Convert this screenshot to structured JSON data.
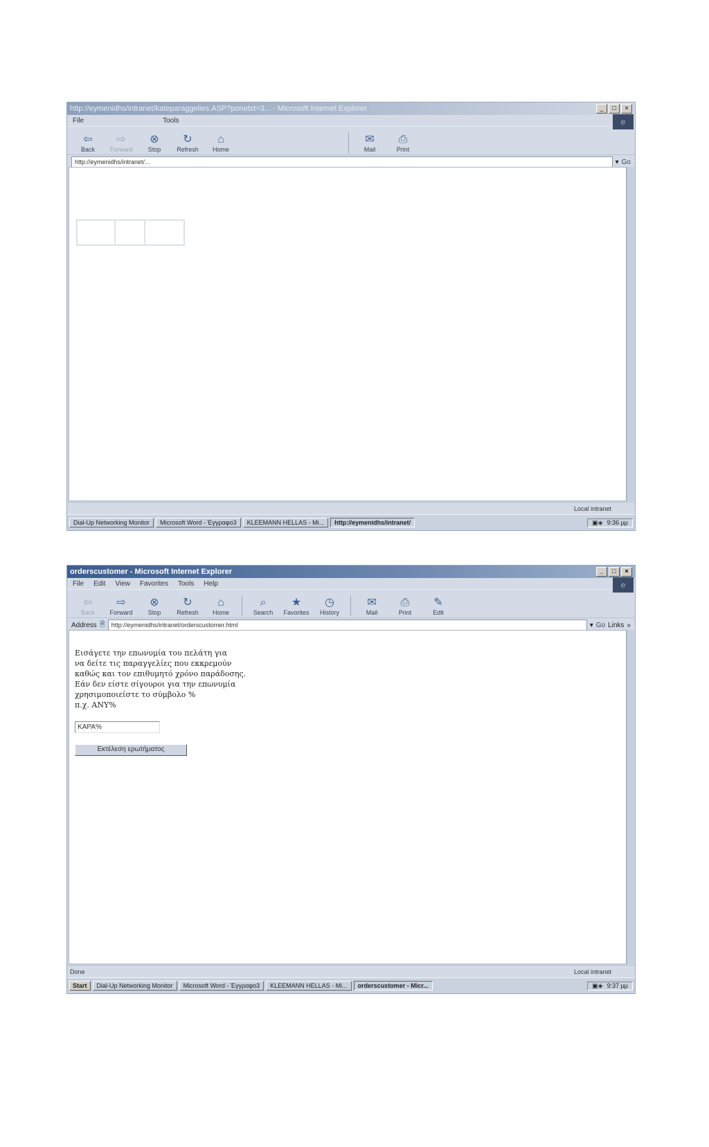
{
  "window1": {
    "title": "http://eymenidhs/intranet/kateparaggelies.ASP?ponetxt=3...  - Microsoft Internet Explorer",
    "menu": [
      "File",
      "Tools"
    ],
    "toolbar": [
      {
        "label": "Back",
        "icon": "back-arrow-icon"
      },
      {
        "label": "Forward",
        "icon": "forward-arrow-icon"
      },
      {
        "label": "Stop",
        "icon": "stop-icon"
      },
      {
        "label": "Refresh",
        "icon": "refresh-icon"
      },
      {
        "label": "Home",
        "icon": "home-icon"
      },
      {
        "label": "Mail",
        "icon": "mail-icon"
      },
      {
        "label": "Print",
        "icon": "print-icon"
      }
    ],
    "address": "http://eymenidhs/intranet/...",
    "go": "Go",
    "status_zone": "Local intranet",
    "taskbar": {
      "tasks": [
        "Dial-Up Networking Monitor",
        "Microsoft Word - Έγγραφο3",
        "KLEEMANN HELLAS - Mi...",
        "http://eymenidhs/intranet/"
      ],
      "clock": "9:36 μμ"
    }
  },
  "window2": {
    "title": "orderscustomer - Microsoft Internet Explorer",
    "menu": [
      "File",
      "Edit",
      "View",
      "Favorites",
      "Tools",
      "Help"
    ],
    "toolbar": [
      {
        "label": "Back",
        "icon": "back-arrow-icon"
      },
      {
        "label": "Forward",
        "icon": "forward-arrow-icon"
      },
      {
        "label": "Stop",
        "icon": "stop-icon"
      },
      {
        "label": "Refresh",
        "icon": "refresh-icon"
      },
      {
        "label": "Home",
        "icon": "home-icon"
      },
      {
        "label": "Search",
        "icon": "search-icon"
      },
      {
        "label": "Favorites",
        "icon": "favorites-icon"
      },
      {
        "label": "History",
        "icon": "history-icon"
      },
      {
        "label": "Mail",
        "icon": "mail-icon"
      },
      {
        "label": "Print",
        "icon": "print-icon"
      },
      {
        "label": "Edit",
        "icon": "edit-icon"
      }
    ],
    "address_label": "Address",
    "address": "http://eymenidhs/intranet/orderscustomer.html",
    "go": "Go",
    "links": "Links",
    "instructions": [
      "Εισάγετε την επωνυμία του πελάτη για",
      "να δείτε τις παραγγελίες που εκκρεμούν",
      "καθώς και τον επιθυμητό χρόνο παράδοσης.",
      "Εάν δεν είστε σίγουροι για την επωνυμία",
      "χρησιμοποιείστε το σύμβολο %",
      "π.χ. ANY%"
    ],
    "input_value": "KAPA%",
    "submit_label": "Εκτέλεση ερωτήματος",
    "status_left": "Done",
    "status_zone": "Local intranet",
    "taskbar": {
      "start": "Start",
      "tasks": [
        "Dial-Up Networking Monitor",
        "Microsoft Word - Έγγραφο3",
        "KLEEMANN HELLAS - Mi...",
        "orderscustomer - Micr..."
      ],
      "clock": "9:37 μμ"
    }
  }
}
